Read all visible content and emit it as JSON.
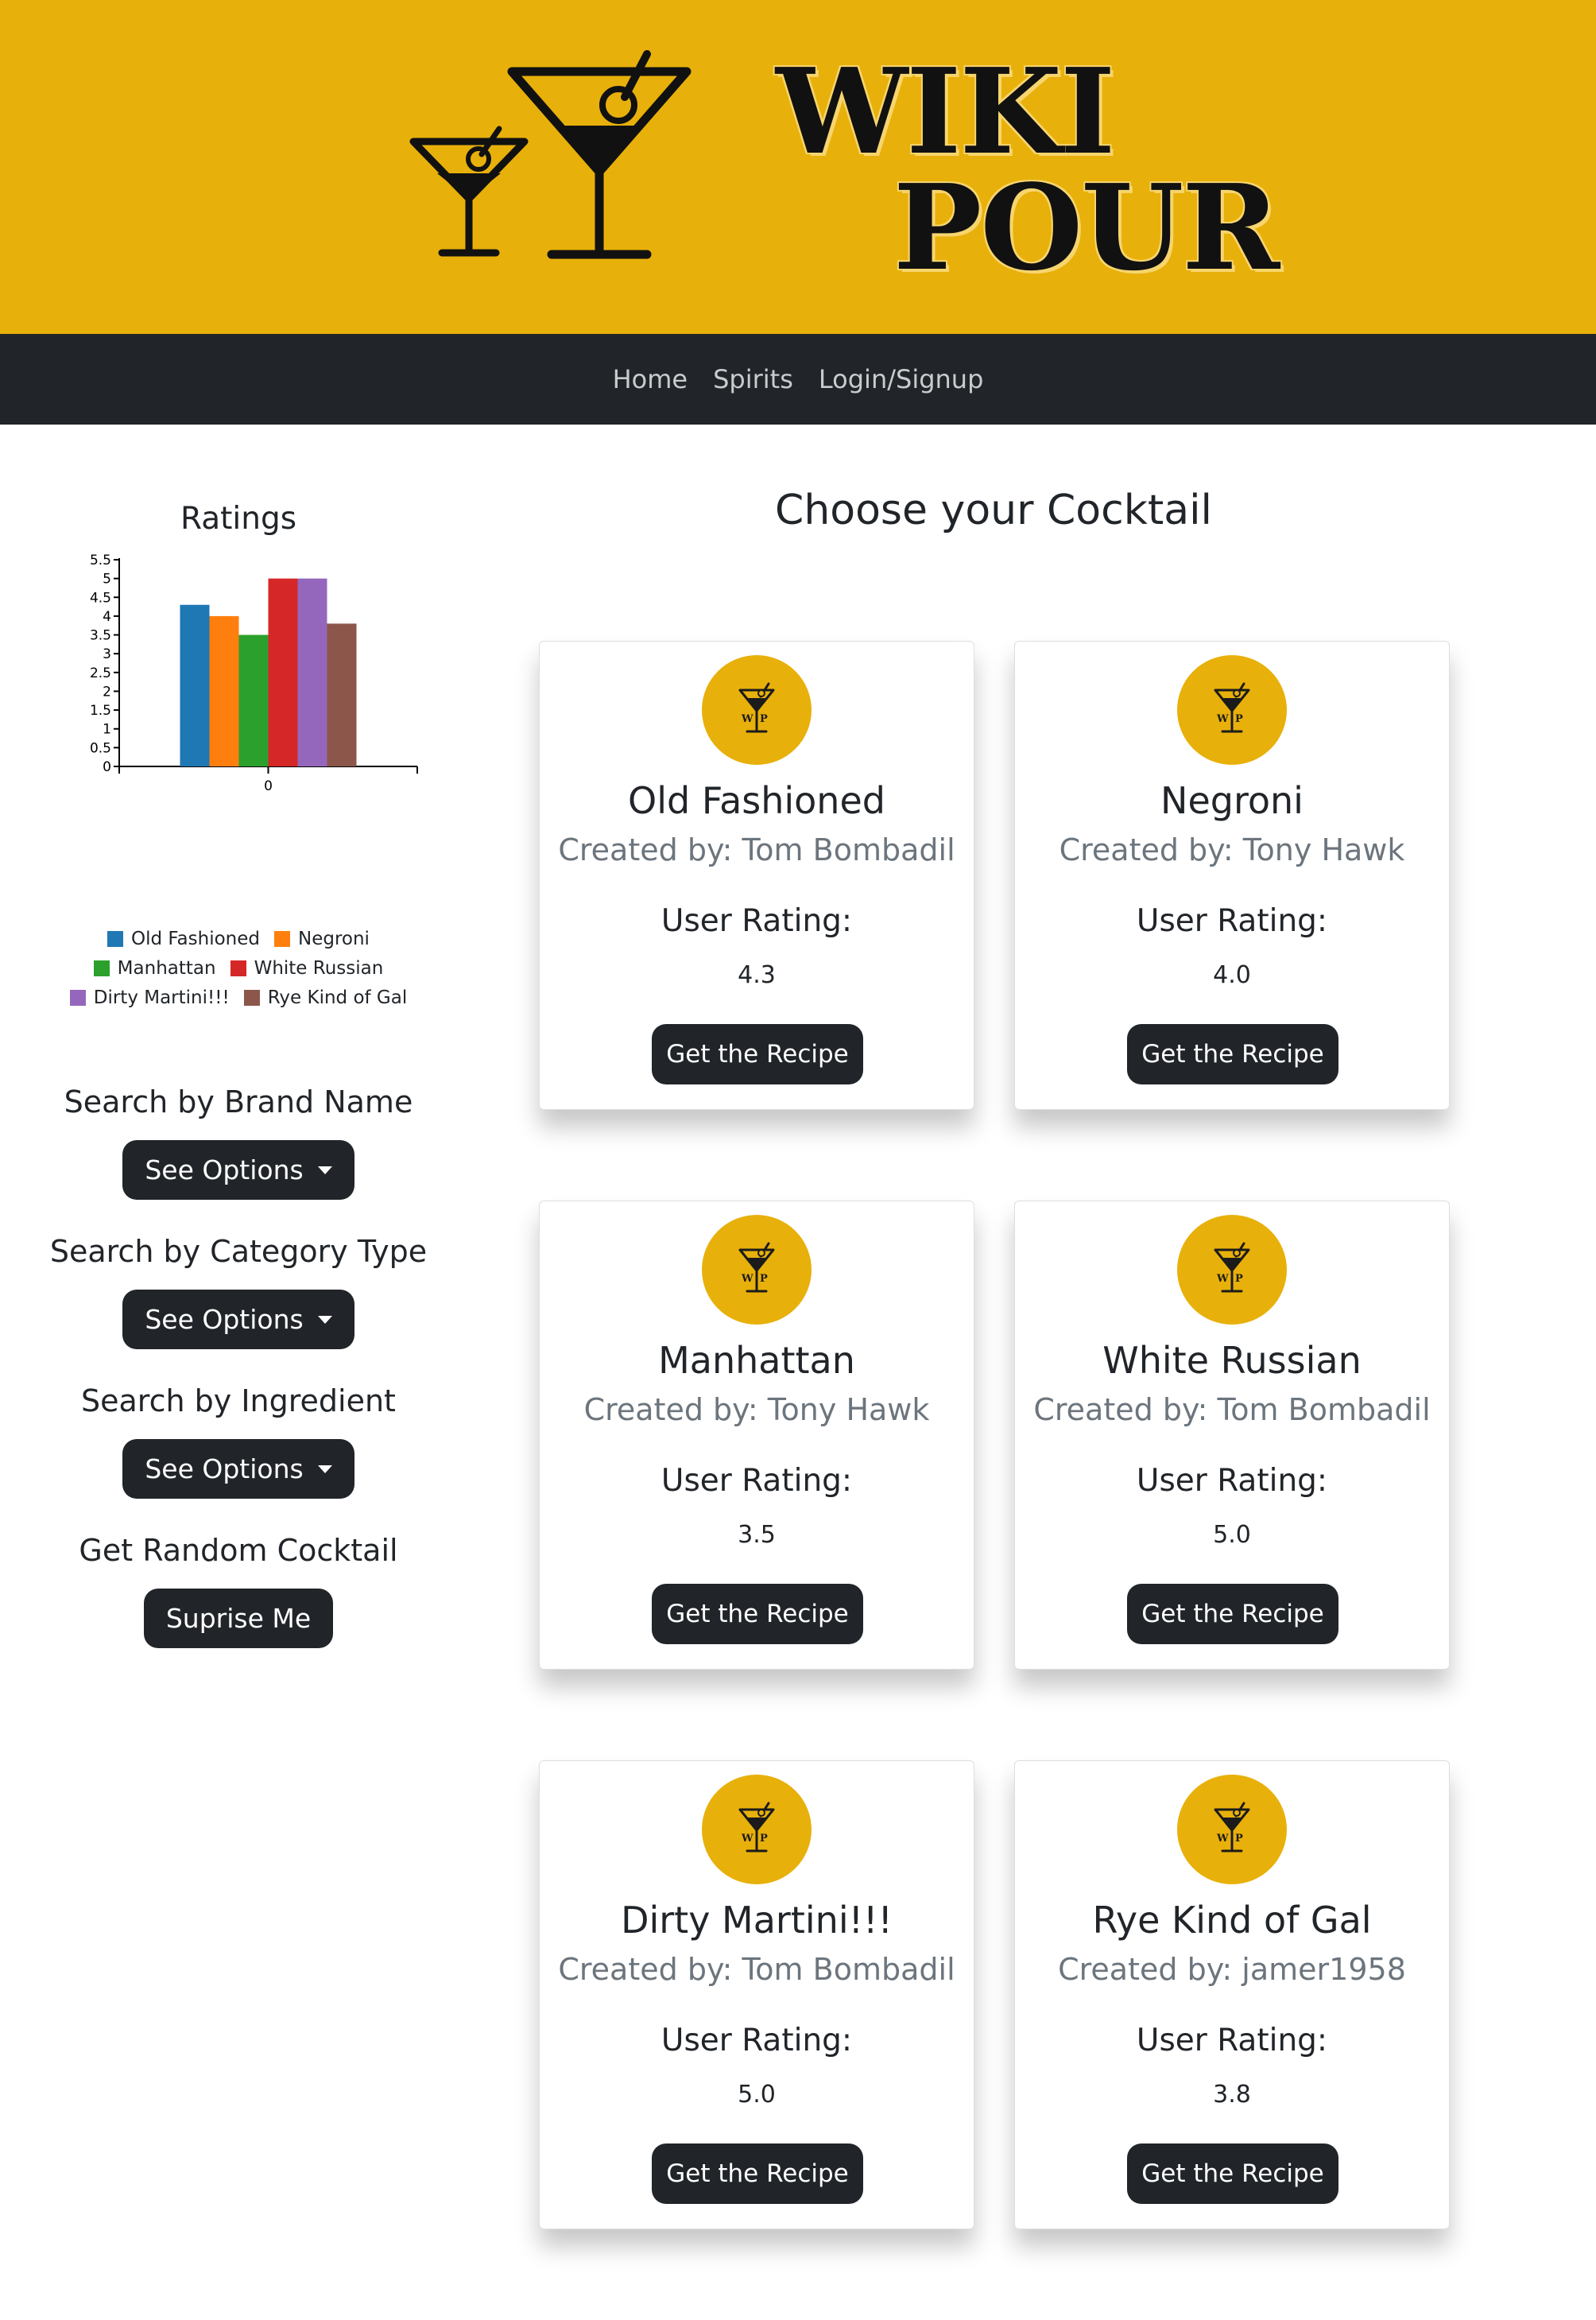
{
  "header": {
    "logo_line1": "WIKI",
    "logo_line2": "POUR",
    "brand_color": "#e8b00a",
    "logo_icon": "martini-glasses-icon"
  },
  "nav": {
    "links": [
      "Home",
      "Spirits",
      "Login/Signup"
    ],
    "background": "#212529"
  },
  "sidebar": {
    "chart_title": "Ratings",
    "searches": [
      {
        "label": "Search by Brand Name",
        "button": "See Options"
      },
      {
        "label": "Search by Category Type",
        "button": "See Options"
      },
      {
        "label": "Search by Ingredient",
        "button": "See Options"
      },
      {
        "label": "Get Random Cocktail",
        "button": "Suprise Me"
      }
    ]
  },
  "chart_data": {
    "type": "bar",
    "title": "Ratings",
    "categories": [
      "0"
    ],
    "series": [
      {
        "name": "Old Fashioned",
        "values": [
          4.3
        ],
        "color": "#1f77b4"
      },
      {
        "name": "Negroni",
        "values": [
          4.0
        ],
        "color": "#ff7f0e"
      },
      {
        "name": "Manhattan",
        "values": [
          3.5
        ],
        "color": "#2ca02c"
      },
      {
        "name": "White Russian",
        "values": [
          5.0
        ],
        "color": "#d62728"
      },
      {
        "name": "Dirty Martini!!!",
        "values": [
          5.0
        ],
        "color": "#9467bd"
      },
      {
        "name": "Rye Kind of Gal",
        "values": [
          3.8
        ],
        "color": "#8c564b"
      }
    ],
    "yticks": [
      "0",
      "0.5",
      "1",
      "1.5",
      "2",
      "2.5",
      "3",
      "3.5",
      "4",
      "4.5",
      "5",
      "5.5"
    ],
    "ylim": [
      0,
      5.5
    ],
    "legend_position": "bottom"
  },
  "main": {
    "title": "Choose your Cocktail",
    "card_icon": "wiki-pour-martini-icon",
    "rating_label": "User Rating:",
    "button_label": "Get the Recipe",
    "cards": [
      {
        "name": "Old Fashioned",
        "creator": "Created by: Tom Bombadil",
        "rating": "4.3"
      },
      {
        "name": "Negroni",
        "creator": "Created by: Tony Hawk",
        "rating": "4.0"
      },
      {
        "name": "Manhattan",
        "creator": "Created by: Tony Hawk",
        "rating": "3.5"
      },
      {
        "name": "White Russian",
        "creator": "Created by: Tom Bombadil",
        "rating": "5.0"
      },
      {
        "name": "Dirty Martini!!!",
        "creator": "Created by: Tom Bombadil",
        "rating": "5.0"
      },
      {
        "name": "Rye Kind of Gal",
        "creator": "Created by: jamer1958",
        "rating": "3.8"
      }
    ]
  }
}
